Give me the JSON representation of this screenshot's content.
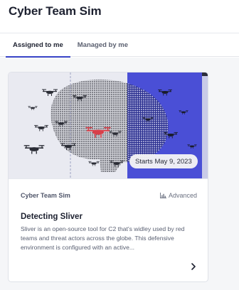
{
  "app": {
    "title": "Cyber Team Sim"
  },
  "tabs": [
    {
      "label": "Assigned to me",
      "active": true
    },
    {
      "label": "Managed by me",
      "active": false
    }
  ],
  "card": {
    "date_badge": "Starts May 9, 2023",
    "category": "Cyber Team Sim",
    "level": "Advanced",
    "level_icon": "bar-chart-icon",
    "title": "Detecting Sliver",
    "description": "Sliver is an open-source tool for C2 that's widley used by red teams and threat actors across the globe. This defensive environment is configured with an active...",
    "chevron_icon": "chevron-right-icon"
  },
  "colors": {
    "accent": "#3945c8",
    "image_left_bg": "#e9eaf1",
    "image_right_bg": "#4a4fd6",
    "drone_highlight": "#d8404a"
  }
}
